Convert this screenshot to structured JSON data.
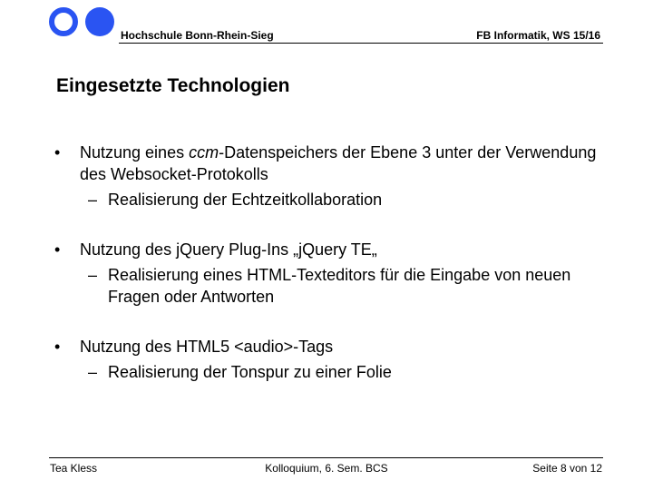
{
  "header": {
    "institution": "Hochschule Bonn-Rhein-Sieg",
    "course": "FB Informatik, WS 15/16"
  },
  "slide": {
    "title": "Eingesetzte Technologien",
    "bullet_symbol": "•",
    "dash_symbol": "–",
    "bullets": [
      {
        "pre": "Nutzung eines ",
        "em": "ccm",
        "post": "-Datenspeichers der Ebene 3 unter der Verwendung des Websocket-Protokolls",
        "sub": "Realisierung der Echtzeitkollaboration"
      },
      {
        "text": "Nutzung des jQuery Plug-Ins „jQuery TE„",
        "sub": "Realisierung eines HTML-Texteditors für die Eingabe von neuen Fragen oder Antworten"
      },
      {
        "text": "Nutzung des HTML5 <audio>-Tags",
        "sub": "Realisierung der Tonspur zu einer Folie"
      }
    ]
  },
  "footer": {
    "author": "Tea Kless",
    "event": "Kolloquium, 6. Sem. BCS",
    "page": "Seite 8 von 12"
  },
  "colors": {
    "logo_blue": "#2a54f2"
  }
}
